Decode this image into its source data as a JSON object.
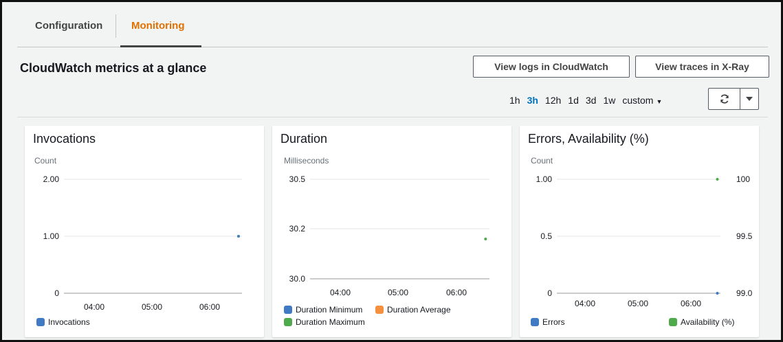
{
  "tabs": {
    "configuration": "Configuration",
    "monitoring": "Monitoring"
  },
  "header": {
    "title": "CloudWatch metrics at a glance",
    "view_logs": "View logs in CloudWatch",
    "view_traces": "View traces in X-Ray"
  },
  "ranges": {
    "items": [
      "1h",
      "3h",
      "12h",
      "1d",
      "3d",
      "1w"
    ],
    "active": "3h",
    "custom": "custom"
  },
  "colors": {
    "blue": "#3f7ac2",
    "orange": "#f5913e",
    "green": "#4fa94d",
    "accent": "#e07000"
  },
  "icons": {
    "refresh": "refresh-icon",
    "dropdown": "caret-down-icon"
  },
  "chart_data": [
    {
      "type": "scatter",
      "title": "Invocations",
      "ylabel": "Count",
      "ylim": [
        0,
        2
      ],
      "yticks": [
        "2.00",
        "1.00",
        "0"
      ],
      "xticks": [
        "04:00",
        "05:00",
        "06:00"
      ],
      "series": [
        {
          "name": "Invocations",
          "color": "#3f7ac2",
          "points": [
            {
              "x": "06:30",
              "y": 1.0
            }
          ]
        }
      ]
    },
    {
      "type": "scatter",
      "title": "Duration",
      "ylabel": "Milliseconds",
      "ylim": [
        30.0,
        30.5
      ],
      "yticks": [
        "30.5",
        "30.2",
        "30.0"
      ],
      "xticks": [
        "04:00",
        "05:00",
        "06:00"
      ],
      "series": [
        {
          "name": "Duration Minimum",
          "color": "#3f7ac2",
          "points": []
        },
        {
          "name": "Duration Average",
          "color": "#f5913e",
          "points": []
        },
        {
          "name": "Duration Maximum",
          "color": "#4fa94d",
          "points": [
            {
              "x": "06:30",
              "y": 30.2
            }
          ]
        }
      ]
    },
    {
      "type": "scatter",
      "title": "Errors, Availability (%)",
      "ylabel": "Count",
      "ylim": [
        0,
        1
      ],
      "yticks": [
        "1.00",
        "0.5",
        "0"
      ],
      "y2ticks": [
        "100",
        "99.5",
        "99.0"
      ],
      "y2lim": [
        99.0,
        100
      ],
      "xticks": [
        "04:00",
        "05:00",
        "06:00"
      ],
      "series": [
        {
          "name": "Errors",
          "color": "#3f7ac2",
          "points": [
            {
              "x": "06:30",
              "y": 0
            }
          ]
        },
        {
          "name": "Availability (%)",
          "color": "#4fa94d",
          "axis": "right",
          "points": [
            {
              "x": "06:30",
              "y": 100
            }
          ]
        }
      ]
    }
  ]
}
